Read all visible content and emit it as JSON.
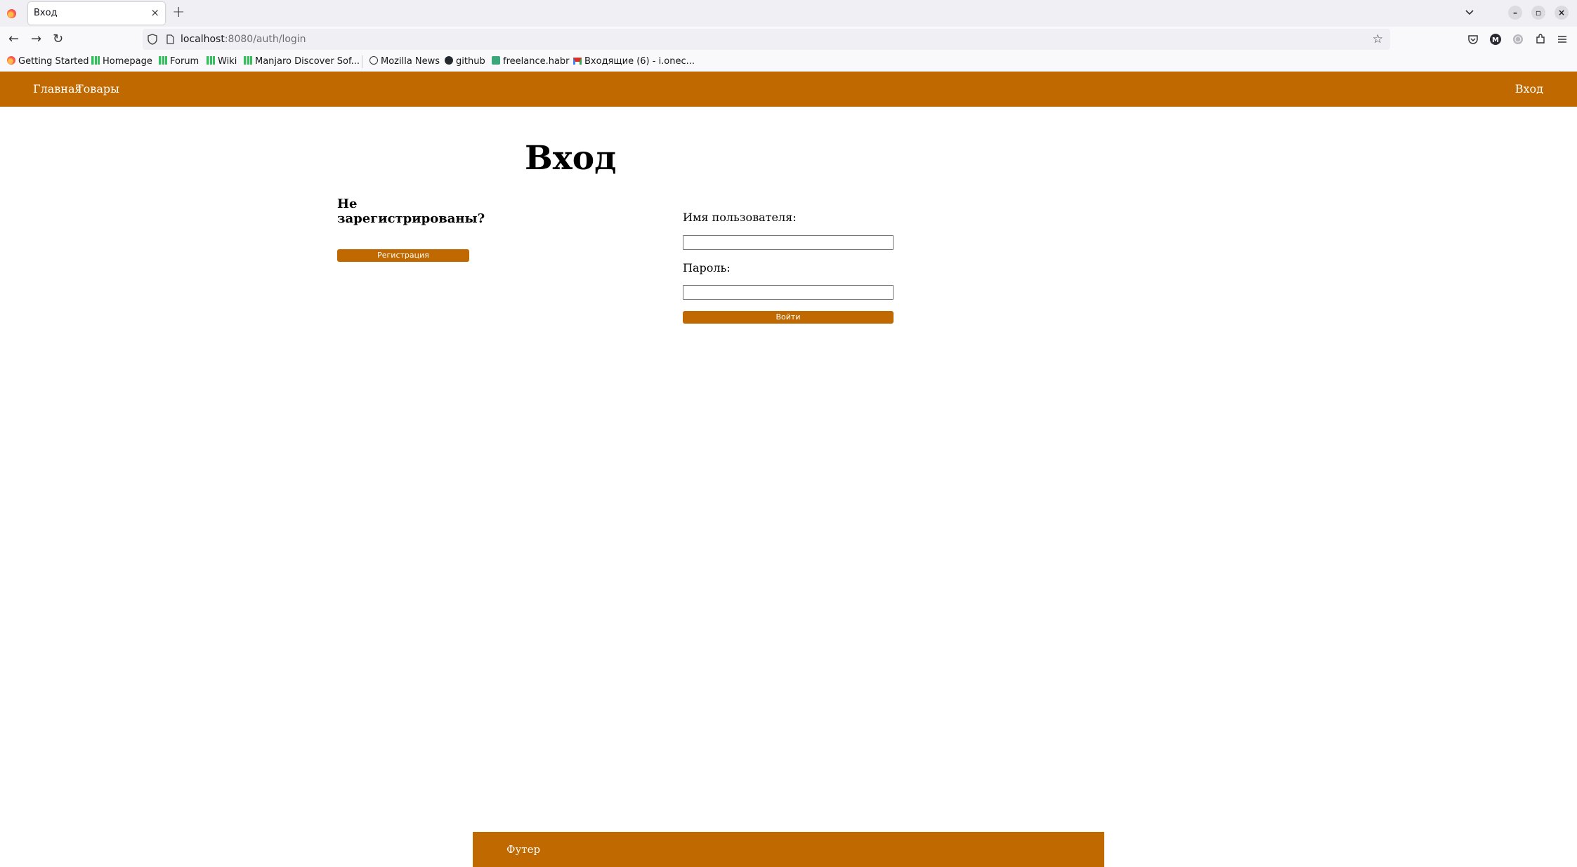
{
  "browser": {
    "tab_title": "Вход",
    "tab_close": "×",
    "new_tab": "+",
    "url_host": "localhost",
    "url_path": ":8080/auth/login",
    "bookmarks": [
      {
        "label": "Getting Started",
        "icon": "firefox-icon"
      },
      {
        "label": "Homepage",
        "icon": "manjaro-icon"
      },
      {
        "label": "Forum",
        "icon": "manjaro-icon"
      },
      {
        "label": "Wiki",
        "icon": "manjaro-icon"
      },
      {
        "label": "Manjaro Discover Sof...",
        "icon": "manjaro-icon"
      },
      {
        "label": "Mozilla News",
        "icon": "globe-icon"
      },
      {
        "label": "github",
        "icon": "github-icon"
      },
      {
        "label": "freelance.habr",
        "icon": "habr-icon"
      },
      {
        "label": "Входящие (6) - i.onec...",
        "icon": "gmail-icon"
      }
    ]
  },
  "header": {
    "nav": [
      "Главная",
      "Товары"
    ],
    "login_link": "Вход"
  },
  "main": {
    "title": "Вход",
    "register_heading": "Не зарегистрированы?",
    "register_button": "Регистрация",
    "username_label": "Имя пользователя:",
    "username_value": "",
    "password_label": "Пароль:",
    "password_value": "",
    "submit_button": "Войти"
  },
  "footer": {
    "text": "Футер"
  },
  "colors": {
    "accent": "#bf6900",
    "chrome_bg": "#f0f0f4"
  }
}
